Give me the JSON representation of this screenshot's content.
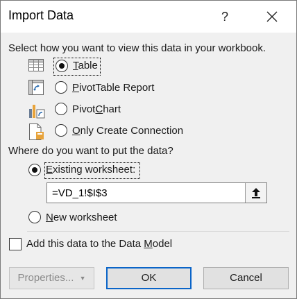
{
  "dialog": {
    "title": "Import Data",
    "help_glyph": "?",
    "close_icon": "close-icon"
  },
  "view_section": {
    "prompt": "Select how you want to view this data in your workbook.",
    "options": [
      {
        "mnemonic": "T",
        "rest": "able",
        "icon": "table-icon",
        "selected": true
      },
      {
        "mnemonic": "P",
        "rest": "ivotTable Report",
        "icon": "pivottable-icon",
        "selected": false
      },
      {
        "prefix": "Pivot",
        "mnemonic": "C",
        "rest": "hart",
        "icon": "pivotchart-icon",
        "selected": false
      },
      {
        "mnemonic": "O",
        "rest": "nly Create Connection",
        "icon": "connection-icon",
        "selected": false
      }
    ]
  },
  "location_section": {
    "prompt": "Where do you want to put the data?",
    "existing": {
      "mnemonic": "E",
      "rest": "xisting worksheet:",
      "selected": true
    },
    "range_value": "=VD_1!$I$3",
    "new": {
      "mnemonic": "N",
      "rest": "ew worksheet",
      "selected": false
    }
  },
  "data_model": {
    "label_prefix": "Add this data to the Data ",
    "mnemonic": "M",
    "label_suffix": "odel",
    "checked": false
  },
  "buttons": {
    "properties": "Properties...",
    "ok": "OK",
    "cancel": "Cancel"
  },
  "colors": {
    "accent": "#0a64c8",
    "dialog_bg": "#f0f0f0"
  }
}
